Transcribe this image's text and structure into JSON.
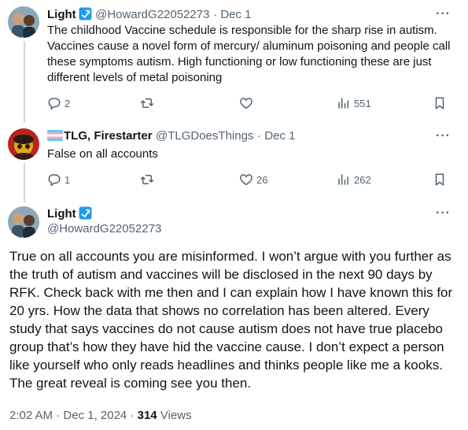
{
  "post1": {
    "name": "Light",
    "handle": "@HowardG22052273",
    "sep": "·",
    "date": "Dec 1",
    "text": "The childhood Vaccine schedule is responsible for the sharp rise in autism. Vaccines cause a novel form of mercury/ aluminum poisoning and people call these symptoms autism. High functioning or low functioning these are just different levels of metal poisoning",
    "replies": "2",
    "reposts": "",
    "likes": "",
    "views": "551"
  },
  "post2": {
    "name": "TLG, Firestarter",
    "handle": "@TLGDoesThings",
    "sep": "·",
    "date": "Dec 1",
    "text": "False on all accounts",
    "replies": "1",
    "reposts": "",
    "likes": "26",
    "views": "262"
  },
  "main": {
    "name": "Light",
    "handle": "@HowardG22052273",
    "text": "True on all accounts you are misinformed. I won’t argue with you further as the truth of autism and vaccines will be disclosed in the next 90 days by RFK. Check back with me then and I can explain how I have known this for 20 yrs. How the data that shows no correlation has been altered. Every study that says vaccines do not cause autism does not have true placebo group that’s how they have hid the vaccine cause. I don’t expect a person like yourself who only reads headlines and thinks people like me a kooks. The great reveal is coming see you then.",
    "time": "2:02 AM",
    "sep": "·",
    "date": "Dec 1, 2024",
    "sep2": "·",
    "views_count": "314",
    "views_label": "Views"
  },
  "more_glyph": "···",
  "colors": {
    "verified": "#1d9bf0",
    "muted": "#536471",
    "text": "#0f1419",
    "flag_blue": "#5bcefa",
    "flag_pink": "#f5a9b8"
  },
  "icons": [
    "verified-badge-icon",
    "reply-icon",
    "repost-icon",
    "like-icon",
    "views-icon",
    "bookmark-icon",
    "more-icon",
    "trans-flag-icon"
  ]
}
